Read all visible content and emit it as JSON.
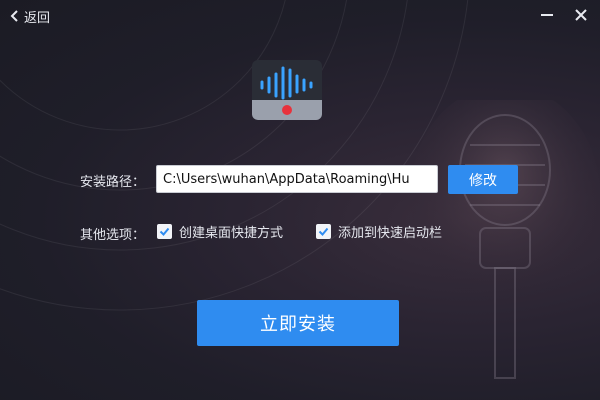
{
  "header": {
    "back_label": "返回"
  },
  "form": {
    "path_label": "安装路径：",
    "path_value": "C:\\Users\\wuhan\\AppData\\Roaming\\Hu",
    "modify_label": "修改",
    "options_label": "其他选项：",
    "options": [
      {
        "label": "创建桌面快捷方式",
        "checked": true
      },
      {
        "label": "添加到快速启动栏",
        "checked": true
      }
    ]
  },
  "install_label": "立即安装",
  "colors": {
    "accent": "#2f8cf0",
    "logo_red": "#e8323c",
    "logo_wave": "#3aa3ff"
  },
  "icons": [
    "back-chevron-icon",
    "minimize-icon",
    "close-icon",
    "app-logo-icon",
    "checkmark-icon"
  ]
}
